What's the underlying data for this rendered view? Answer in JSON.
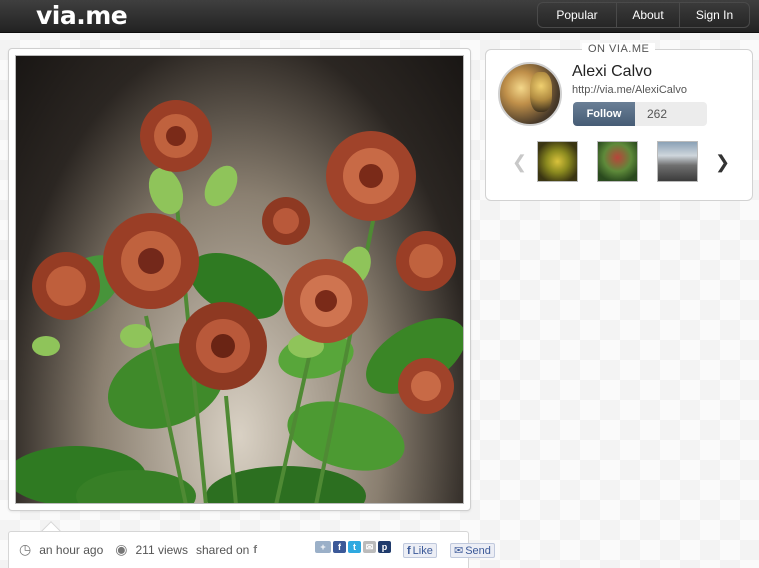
{
  "header": {
    "logo": "via.me",
    "nav": [
      {
        "label": "Popular"
      },
      {
        "label": "About"
      },
      {
        "label": "Sign In"
      }
    ]
  },
  "post": {
    "time": "an hour ago",
    "views": "211 views",
    "shared_on": "shared on",
    "like_label": "Like",
    "send_label": "Send"
  },
  "profile": {
    "section_label": "ON VIA.ME",
    "name": "Alexi Calvo",
    "url": "http://via.me/AlexiCalvo",
    "follow_label": "Follow",
    "follower_count": "262"
  },
  "colors": {
    "topbar": "#2a2a2a",
    "follow_button": "#52677f",
    "facebook": "#3b5998",
    "twitter": "#2fa9e0",
    "pinterest": "#1f3a6b"
  }
}
